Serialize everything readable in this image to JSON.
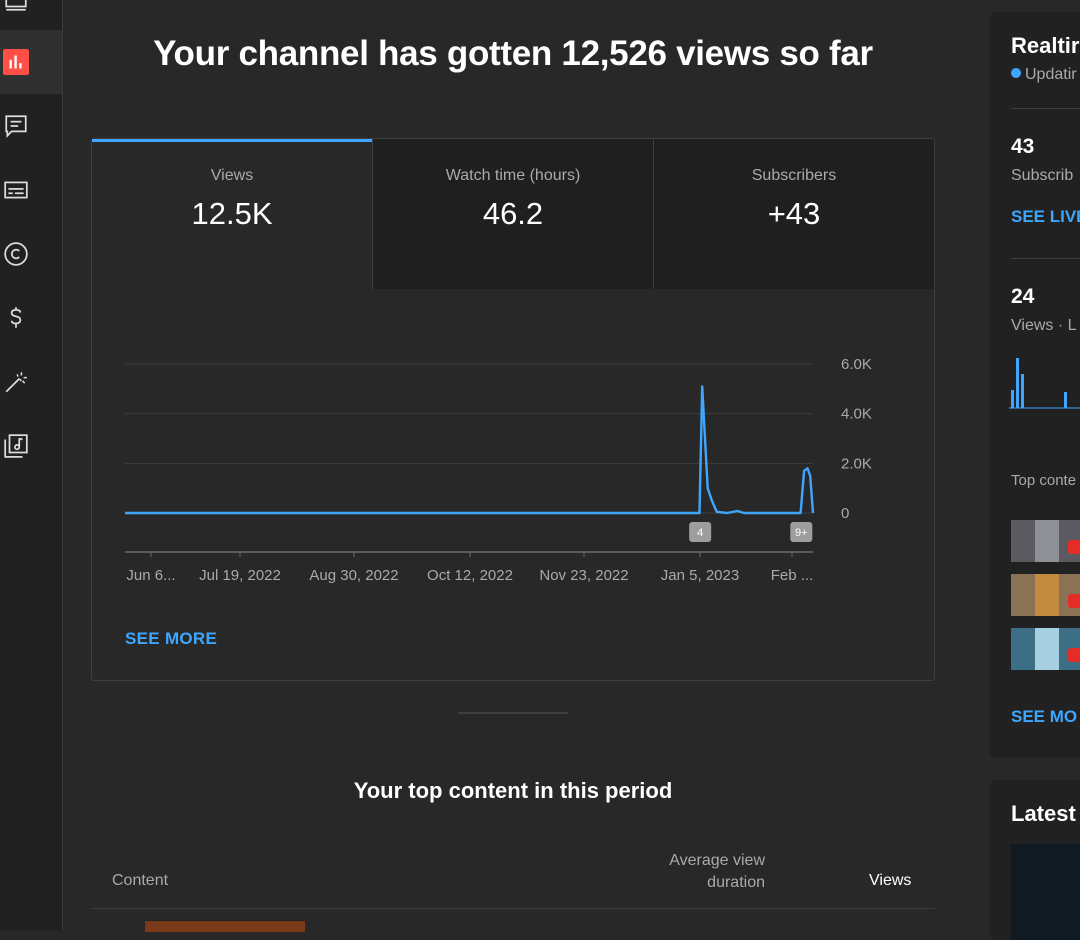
{
  "headline": "Your channel has gotten 12,526 views so far",
  "tabs": [
    {
      "label": "Views",
      "value": "12.5K"
    },
    {
      "label": "Watch time (hours)",
      "value": "46.2"
    },
    {
      "label": "Subscribers",
      "value": "+43"
    }
  ],
  "see_more": "SEE MORE",
  "top_content": {
    "title": "Your top content in this period",
    "col_content": "Content",
    "col_avd": "Average view duration",
    "col_views": "Views"
  },
  "realtime": {
    "title": "Realtir",
    "status": "Updatir",
    "subscribers_value": "43",
    "subscribers_label": "Subscrib",
    "see_live": "SEE LIVE",
    "views_value": "24",
    "views_label": "Views · L",
    "top_content_label": "Top conte",
    "see_more": "SEE MO"
  },
  "latest": {
    "title": "Latest"
  },
  "chart_data": {
    "type": "line",
    "x_tick_labels": [
      "Jun 6...",
      "Jul 19, 2022",
      "Aug 30, 2022",
      "Oct 12, 2022",
      "Nov 23, 2022",
      "Jan 5, 2023",
      "Feb ..."
    ],
    "y_tick_labels": [
      "6.0K",
      "4.0K",
      "2.0K",
      "0"
    ],
    "ylim": [
      0,
      6000
    ],
    "series": [
      {
        "values": [
          {
            "x": 0,
            "y": 0
          },
          {
            "x": 0.835,
            "y": 0
          },
          {
            "x": 0.839,
            "y": 5100
          },
          {
            "x": 0.843,
            "y": 3000
          },
          {
            "x": 0.847,
            "y": 1000
          },
          {
            "x": 0.853,
            "y": 500
          },
          {
            "x": 0.86,
            "y": 50
          },
          {
            "x": 0.875,
            "y": 0
          },
          {
            "x": 0.89,
            "y": 80
          },
          {
            "x": 0.9,
            "y": 0
          },
          {
            "x": 0.982,
            "y": 0
          },
          {
            "x": 0.987,
            "y": 1700
          },
          {
            "x": 0.992,
            "y": 1800
          },
          {
            "x": 0.996,
            "y": 1500
          },
          {
            "x": 1.0,
            "y": 0
          }
        ]
      }
    ],
    "markers": [
      {
        "x": 0.836,
        "label": "4"
      },
      {
        "x": 0.983,
        "label": "9+"
      }
    ],
    "grid": true,
    "colors": {
      "line": "#3ea6ff",
      "grid": "#3e3e3e"
    }
  }
}
